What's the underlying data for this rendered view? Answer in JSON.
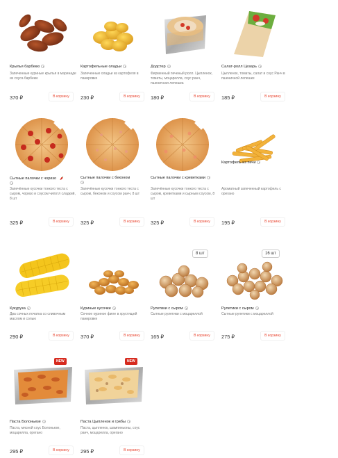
{
  "currency": "₽",
  "add_label": "В корзину",
  "items": [
    {
      "name": "Крылья барбекю",
      "desc": "Запеченные куриные крылья в маринаде из соуса барбекю",
      "price": "370 ₽"
    },
    {
      "name": "Картофельные оладьи",
      "desc": "Запеченные оладьи из картофеля в панировке",
      "price": "230 ₽"
    },
    {
      "name": "Додстер",
      "desc": "Фирменный печеный ролл. Цыпленок, томаты, моцарелла, соус ранч, пшеничная лепешка",
      "price": "180 ₽"
    },
    {
      "name": "Салат-ролл Цезарь",
      "desc": "Цыпленок, томаты, салат и соус Ранч в пшеничной лепешке",
      "price": "185 ₽"
    },
    {
      "name": "Сытные палочки с чоризо",
      "desc": "Запечённые кусочки тонкого теста с сыром, чоризо и соусом чипотл сладкий, 8 шт",
      "price": "325 ₽"
    },
    {
      "name": "Сытные палочки с беконом",
      "desc": "Запечённые кусочки тонкого теста с сыром, беконом и соусом ранч, 8 шт",
      "price": "325 ₽"
    },
    {
      "name": "Сытные палочки с креветками",
      "desc": "Запечённые кусочки тонкого теста с сыром, креветками и сырным соусом, 8 шт",
      "price": "325 ₽"
    },
    {
      "name": "Картофель из печи",
      "desc": "Ароматный запеченный картофель с орегано",
      "price": "195 ₽"
    },
    {
      "name": "Кукуруза",
      "desc": "Два сочных початка со сливочным маслом и солью",
      "price": "290 ₽"
    },
    {
      "name": "Куриные кусочки",
      "desc": "Сочное куриное филе в хрустящей панировке",
      "price": "370 ₽"
    },
    {
      "name": "Рулетики с сыром",
      "desc": "Сытные рулетики с моцареллой",
      "price": "165 ₽",
      "badge": "8 шт"
    },
    {
      "name": "Рулетики с сыром",
      "desc": "Сытные рулетики с моцареллой",
      "price": "275 ₽",
      "badge": "16 шт"
    },
    {
      "name": "Паста Болоньезе",
      "desc": "Паста, мясной соус Болоньезе, моцарелла, орегано",
      "price": "295 ₽",
      "badge_new": "NEW"
    },
    {
      "name": "Паста Цыпленок и грибы",
      "desc": "Паста, цыпленок, шампиньоны, соус ранч, моцарелла, орегано",
      "price": "295 ₽",
      "badge_new": "NEW"
    }
  ],
  "colors": {
    "accent": "#e8432e",
    "new_badge": "#d62b1f"
  }
}
